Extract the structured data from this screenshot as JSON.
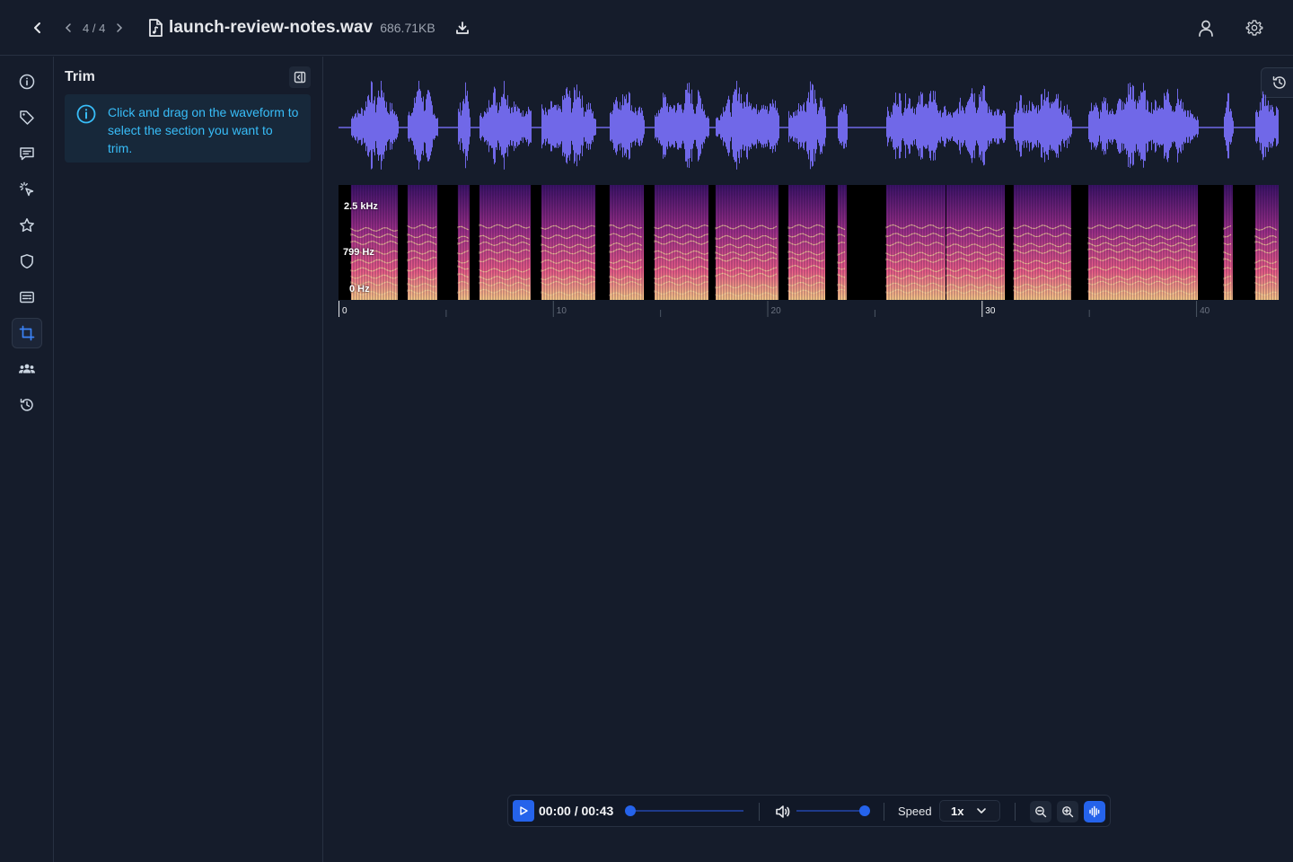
{
  "header": {
    "pager": "4 / 4",
    "file_name": "launch-review-notes.wav",
    "file_size": "686.71KB"
  },
  "rail": {
    "items": [
      {
        "name": "info-icon"
      },
      {
        "name": "tag-icon"
      },
      {
        "name": "comment-icon"
      },
      {
        "name": "magic-cursor-icon"
      },
      {
        "name": "star-icon"
      },
      {
        "name": "shield-icon"
      },
      {
        "name": "captions-icon"
      },
      {
        "name": "crop-icon",
        "active": true
      },
      {
        "name": "users-icon"
      },
      {
        "name": "history-icon"
      }
    ]
  },
  "panel": {
    "title": "Trim",
    "info_text": "Click and drag on the waveform to select the section you want to trim."
  },
  "spectrogram": {
    "freq_labels": [
      "2.5 kHz",
      "799 Hz",
      "0 Hz"
    ]
  },
  "timeline": {
    "duration_s": 43,
    "labels": [
      "0",
      "10",
      "20",
      "30",
      "40"
    ]
  },
  "player": {
    "time": "00:00 / 00:43",
    "progress": 0,
    "volume": 1,
    "speed_label": "Speed",
    "speed_value": "1x"
  },
  "colors": {
    "waveform": "#7068e8",
    "accent": "#2563eb",
    "info": "#38bdf8"
  }
}
